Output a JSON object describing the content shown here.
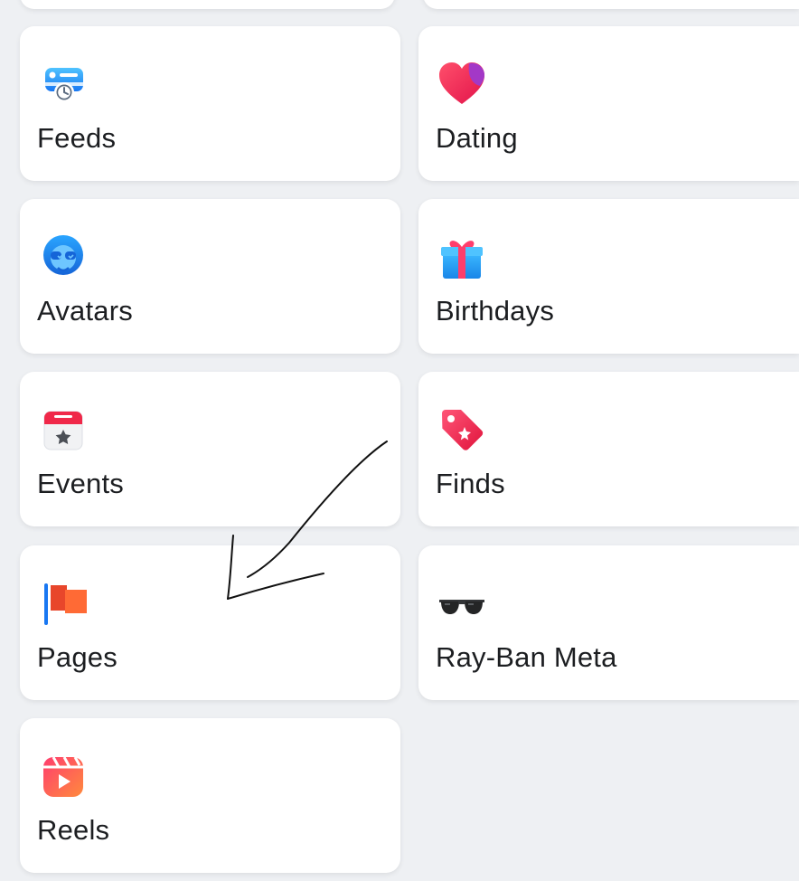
{
  "shortcuts": [
    {
      "label": "Feeds",
      "icon": "feeds-icon"
    },
    {
      "label": "Dating",
      "icon": "dating-heart-icon"
    },
    {
      "label": "Avatars",
      "icon": "avatars-icon"
    },
    {
      "label": "Birthdays",
      "icon": "birthday-gift-icon"
    },
    {
      "label": "Events",
      "icon": "events-calendar-icon"
    },
    {
      "label": "Finds",
      "icon": "finds-tag-icon"
    },
    {
      "label": "Pages",
      "icon": "pages-flag-icon"
    },
    {
      "label": "Ray-Ban Meta",
      "icon": "sunglasses-icon"
    },
    {
      "label": "Reels",
      "icon": "reels-icon"
    }
  ],
  "colors": {
    "background": "#eef0f3",
    "card": "#ffffff",
    "text": "#1c1e21",
    "annotation": "#111111"
  }
}
